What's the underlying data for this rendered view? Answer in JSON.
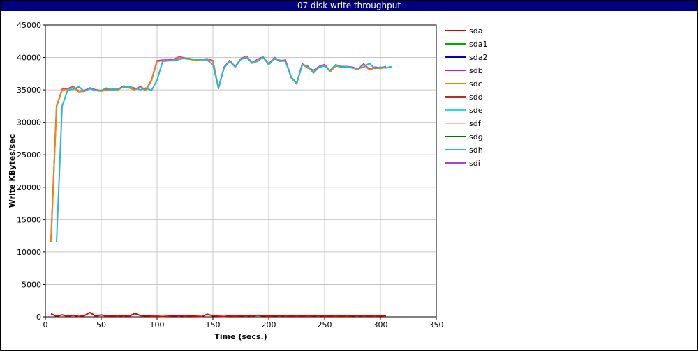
{
  "window": {
    "title": "07 disk write throughput"
  },
  "chart_data": {
    "type": "line",
    "title": "07 disk write throughput",
    "xlabel": "Time (secs.)",
    "ylabel": "Write KBytes/sec",
    "xlim": [
      0,
      350
    ],
    "ylim": [
      0,
      45000
    ],
    "x_ticks": [
      0,
      50,
      100,
      150,
      200,
      250,
      300,
      350
    ],
    "y_ticks": [
      0,
      5000,
      10000,
      15000,
      20000,
      25000,
      30000,
      35000,
      40000,
      45000
    ],
    "grid": true,
    "legend_position": "right",
    "series": [
      {
        "name": "sda",
        "color": "#dd0000",
        "x": [
          5,
          10,
          15,
          20,
          25,
          30,
          35,
          40,
          45,
          50,
          55,
          60,
          65,
          70,
          75,
          80,
          85,
          90,
          95,
          100,
          105,
          110,
          115,
          120,
          125,
          130,
          135,
          140,
          145,
          150,
          155,
          160,
          165,
          170,
          175,
          180,
          185,
          190,
          195,
          200,
          205,
          210,
          215,
          220,
          225,
          230,
          235,
          240,
          245,
          250,
          255,
          260,
          265,
          270,
          275,
          280,
          285,
          290,
          295,
          300,
          305
        ],
        "y": [
          450,
          100,
          300,
          100,
          250,
          50,
          200,
          650,
          100,
          300,
          100,
          150,
          100,
          200,
          100,
          500,
          200,
          150,
          100,
          100,
          50,
          100,
          150,
          200,
          100,
          150,
          100,
          50,
          400,
          150,
          100,
          50,
          150,
          100,
          150,
          200,
          100,
          250,
          150,
          100,
          150,
          200,
          100,
          150,
          100,
          150,
          100,
          150,
          200,
          100,
          150,
          100,
          150,
          100,
          150,
          200,
          100,
          150,
          100,
          150,
          100
        ]
      },
      {
        "name": "sda1",
        "color": "#00aa00",
        "x": [],
        "y": []
      },
      {
        "name": "sda2",
        "color": "#0000cc",
        "x": [],
        "y": []
      },
      {
        "name": "sdb",
        "color": "#ee00ee",
        "x": [
          5,
          10,
          15,
          20,
          25,
          30,
          35,
          40,
          45,
          50,
          55,
          60,
          65,
          70,
          75,
          80,
          85,
          90,
          95,
          100,
          105,
          110,
          115,
          120,
          125,
          130,
          135,
          140,
          145,
          150,
          155,
          160,
          165,
          170,
          175,
          180,
          185,
          190,
          195,
          200,
          205,
          210,
          215,
          220,
          225,
          230,
          235,
          240,
          245,
          250,
          255,
          260,
          265,
          270,
          275,
          280,
          285,
          290,
          295,
          300,
          305
        ],
        "y": [
          11800,
          32500,
          35100,
          35200,
          35500,
          34800,
          34900,
          35300,
          35000,
          34900,
          35100,
          35100,
          35100,
          35600,
          35400,
          35100,
          35500,
          35000,
          36500,
          39500,
          39600,
          39600,
          39700,
          40100,
          39900,
          39800,
          39600,
          39700,
          39800,
          39500,
          35300,
          38500,
          39500,
          38600,
          39800,
          40200,
          39200,
          39700,
          40100,
          39000,
          40000,
          39500,
          39600,
          37000,
          36000,
          39000,
          38500,
          38000,
          38600,
          38900,
          37900,
          38800,
          38600,
          38600,
          38500,
          38200,
          39000,
          38200,
          38500,
          38400,
          38600
        ]
      },
      {
        "name": "sdc",
        "color": "#ee8800",
        "x": [
          5,
          10,
          15,
          20,
          25,
          30,
          35,
          40,
          45,
          50,
          55,
          60,
          65,
          70,
          75,
          80,
          85,
          90,
          95,
          100,
          105,
          110,
          115,
          120,
          125,
          130,
          135,
          140,
          145,
          150,
          155,
          160,
          165,
          170,
          175,
          180,
          185,
          190,
          195,
          200,
          205,
          210,
          215,
          220,
          225,
          230,
          235,
          240,
          245,
          250,
          255,
          260,
          265,
          270,
          275,
          280,
          285,
          290,
          295,
          300,
          305
        ],
        "y": [
          11500,
          32400,
          35000,
          35100,
          35400,
          34700,
          34800,
          35200,
          34900,
          34800,
          35000,
          35000,
          35000,
          35500,
          35300,
          35000,
          35400,
          34900,
          36400,
          39400,
          39500,
          39500,
          39600,
          40000,
          39800,
          39700,
          39500,
          39600,
          39700,
          39400,
          35200,
          38400,
          39400,
          38500,
          39700,
          40100,
          39100,
          39600,
          40000,
          38900,
          39900,
          39400,
          39500,
          36900,
          35900,
          38900,
          38400,
          37900,
          38500,
          38800,
          37800,
          38700,
          38500,
          38500,
          38400,
          38100,
          38900,
          38100,
          38400,
          38300,
          38500
        ]
      },
      {
        "name": "sdd",
        "color": "#aa3333",
        "x": [],
        "y": []
      },
      {
        "name": "sde",
        "color": "#22dddd",
        "x": [],
        "y": []
      },
      {
        "name": "sdf",
        "color": "#ffbbbb",
        "x": [],
        "y": []
      },
      {
        "name": "sdg",
        "color": "#007700",
        "x": [],
        "y": []
      },
      {
        "name": "sdh",
        "color": "#22bbcc",
        "x": [
          10,
          15,
          20,
          25,
          30,
          35,
          40,
          45,
          50,
          55,
          60,
          65,
          70,
          75,
          80,
          85,
          90,
          95,
          100,
          105,
          110,
          115,
          120,
          125,
          130,
          135,
          140,
          145,
          150,
          155,
          160,
          165,
          170,
          175,
          180,
          185,
          190,
          195,
          200,
          205,
          210,
          215,
          220,
          225,
          230,
          235,
          240,
          245,
          250,
          255,
          260,
          265,
          270,
          275,
          280,
          285,
          290,
          295,
          300,
          305,
          310
        ],
        "y": [
          11500,
          32500,
          35000,
          35100,
          35500,
          34800,
          35200,
          34900,
          34900,
          35300,
          35000,
          35200,
          35400,
          35500,
          35300,
          35000,
          35300,
          34900,
          36500,
          39400,
          39500,
          39500,
          39700,
          39900,
          39800,
          39700,
          39700,
          39600,
          38900,
          35300,
          38400,
          39400,
          38600,
          39700,
          40000,
          39200,
          39400,
          40100,
          38900,
          39800,
          39600,
          39400,
          37000,
          36000,
          38900,
          38700,
          37600,
          38500,
          38700,
          38000,
          38900,
          38500,
          38600,
          38400,
          38300,
          38500,
          39100,
          38300,
          38500,
          38400,
          38600
        ]
      },
      {
        "name": "sdi",
        "color": "#aa44cc",
        "x": [],
        "y": []
      }
    ]
  }
}
